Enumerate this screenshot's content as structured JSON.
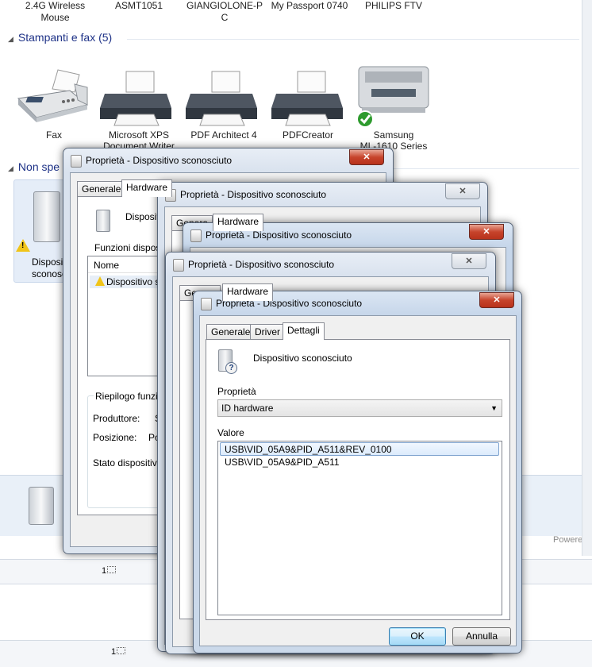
{
  "top_devices": [
    {
      "line1": "2.4G Wireless",
      "line2": "Mouse"
    },
    {
      "line1": "ASMT1051",
      "line2": ""
    },
    {
      "line1": "GIANGIOLONE-P",
      "line2": "C"
    },
    {
      "line1": "My Passport 0740",
      "line2": ""
    },
    {
      "line1": "PHILIPS FTV",
      "line2": ""
    }
  ],
  "group_printers": {
    "label": "Stampanti e fax (5)"
  },
  "printers": [
    {
      "line1": "Fax",
      "line2": ""
    },
    {
      "line1": "Microsoft XPS",
      "line2": "Document Writer"
    },
    {
      "line1": "PDF Architect 4",
      "line2": ""
    },
    {
      "line1": "PDFCreator",
      "line2": ""
    },
    {
      "line1": "Samsung",
      "line2": "ML-1610 Series"
    }
  ],
  "group_unspecified": {
    "label": "Non spe"
  },
  "unspecified_tile": {
    "line1": "Disposit",
    "line2": "sconosc"
  },
  "status_items": {
    "item1": "1",
    "item2": "1"
  },
  "powered_partial": "Powere",
  "window_title": "Proprietà - Dispositivo sconosciuto",
  "close_glyph": "✕",
  "win1": {
    "tabs": [
      "Generale",
      "Hardware"
    ],
    "device_label": "Dispositi",
    "functions_label": "Funzioni dispositiv",
    "col_name": "Nome",
    "row_device": "Dispositivo sco",
    "summary_label": "Riepilogo funzion",
    "manufacturer_label": "Produttore:",
    "manufacturer_value": "S",
    "position_label": "Posizione:",
    "position_value": "Po",
    "status_label": "Stato dispositivo:"
  },
  "win2": {
    "tabs": [
      "Genera",
      "Hardware"
    ]
  },
  "win4": {
    "tabs": [
      "Genera",
      "Hardware"
    ]
  },
  "win5": {
    "tabs": [
      "Generale",
      "Driver",
      "Dettagli"
    ],
    "device_name": "Dispositivo sconosciuto",
    "property_label": "Proprietà",
    "property_selected": "ID hardware",
    "value_label": "Valore",
    "values": [
      "USB\\VID_05A9&PID_A511&REV_0100",
      "USB\\VID_05A9&PID_A511"
    ],
    "ok_label": "OK",
    "cancel_label": "Annulla"
  }
}
